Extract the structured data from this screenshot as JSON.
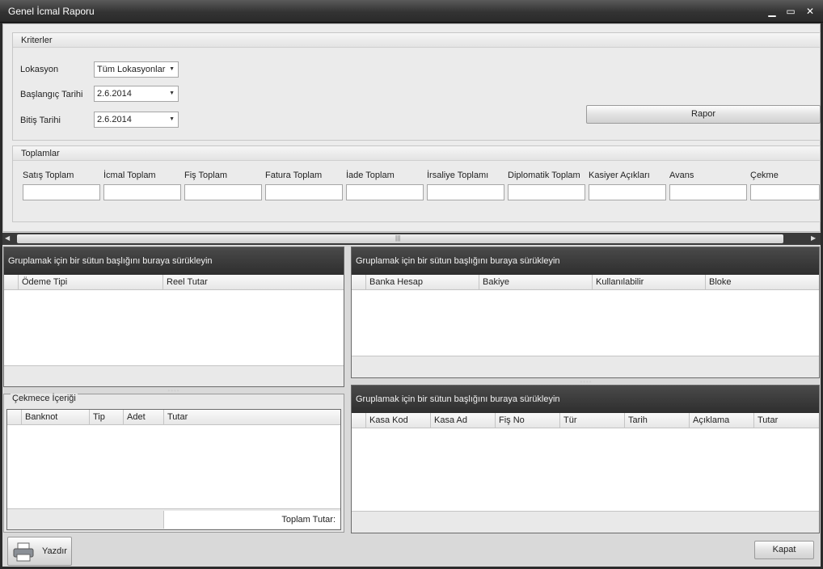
{
  "window": {
    "title": "Genel İcmal Raporu",
    "minimize": "▁",
    "maximize": "▭",
    "close": "✕"
  },
  "criteria": {
    "title": "Kriterler",
    "location_label": "Lokasyon",
    "location_value": "Tüm Lokasyonlar",
    "start_label": "Başlangıç Tarihi",
    "start_value": "2.6.2014",
    "end_label": "Bitiş Tarihi",
    "end_value": "2.6.2014",
    "report_button": "Rapor"
  },
  "totals": {
    "title": "Toplamlar",
    "fields": [
      "Satış Toplam",
      "İcmal Toplam",
      "Fiş Toplam",
      "Fatura Toplam",
      "İade Toplam",
      "İrsaliye Toplamı",
      "Diplomatik Toplam",
      "Kasiyer Açıkları",
      "Avans",
      "Çekme"
    ]
  },
  "group_hint": "Gruplamak için bir sütun başlığını buraya sürükleyin",
  "payment_grid": {
    "columns": [
      "Ödeme Tipi",
      "Reel Tutar"
    ]
  },
  "bank_grid": {
    "columns": [
      "Banka Hesap",
      "Bakiye",
      "Kullanılabilir",
      "Bloke"
    ]
  },
  "drawer": {
    "title": "Çekmece İçeriği",
    "columns": [
      "Banknot",
      "Tip",
      "Adet",
      "Tutar"
    ],
    "total_label": "Toplam Tutar:"
  },
  "cash_grid": {
    "columns": [
      "Kasa Kod",
      "Kasa Ad",
      "Fiş No",
      "Tür",
      "Tarih",
      "Açıklama",
      "Tutar"
    ]
  },
  "footer": {
    "print_button": "Yazdır",
    "close_button": "Kapat"
  },
  "icons": [
    "dropdown-arrow-icon",
    "printer-icon",
    "scroll-left-icon",
    "scroll-right-icon"
  ]
}
